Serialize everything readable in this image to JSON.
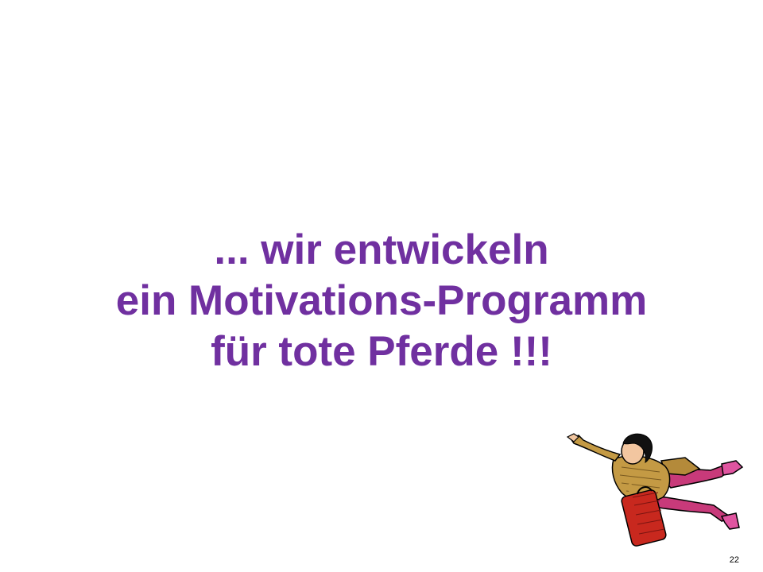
{
  "slide": {
    "headline_lines": [
      "... wir entwickeln",
      "ein Motivations-Programm",
      "für tote Pferde !!!"
    ],
    "page_number": "22",
    "clipart": "flying-businesswoman-with-suitcase-icon",
    "colors": {
      "headline": "#7030a0",
      "background": "#ffffff"
    }
  }
}
